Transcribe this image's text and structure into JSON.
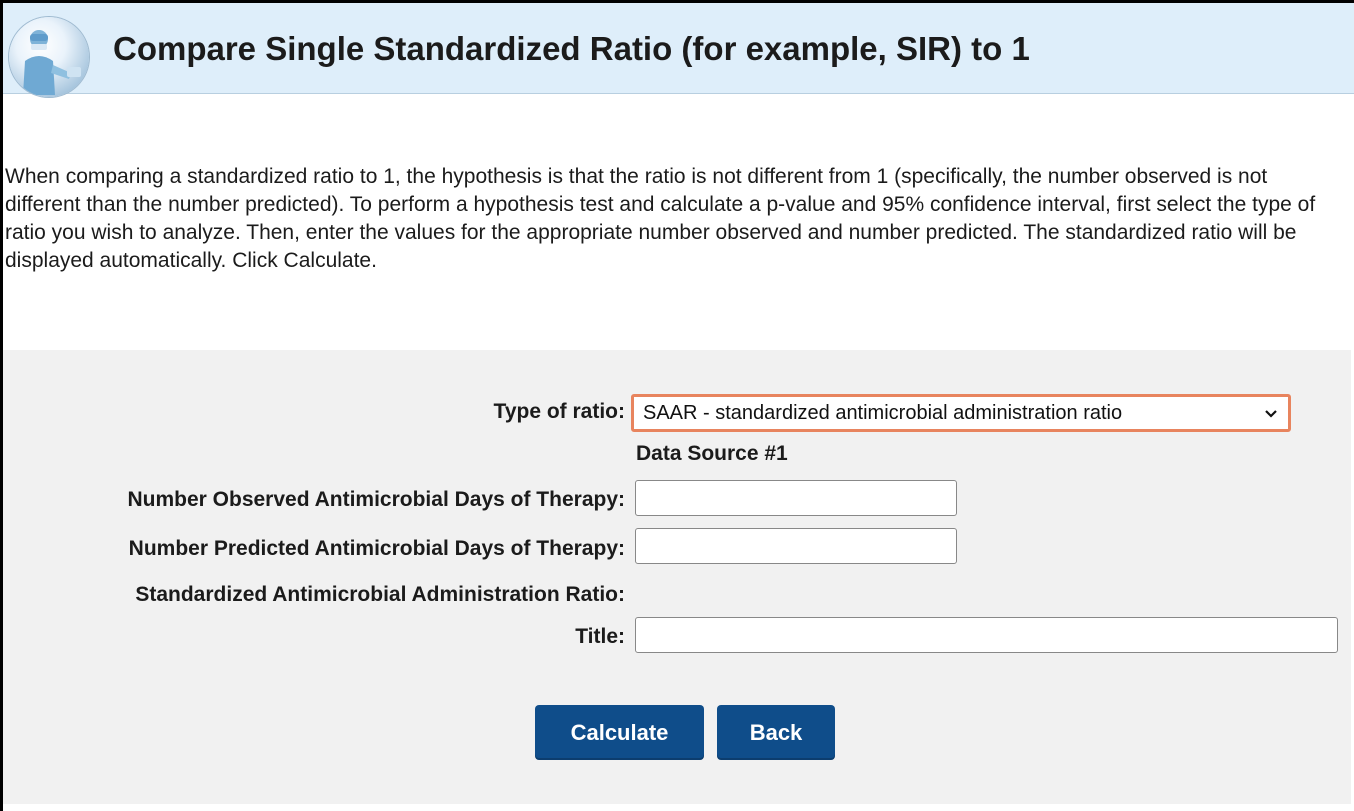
{
  "header": {
    "title": "Compare Single Standardized Ratio (for example, SIR) to 1",
    "logo_icon": "healthcare-worker-logo"
  },
  "intro": {
    "text": "When comparing a standardized ratio to 1, the hypothesis is that the ratio is not different from 1 (specifically, the number observed is not different than the number predicted). To perform a hypothesis test and calculate a p-value and 95% confidence interval, first select the type of ratio you wish to analyze. Then, enter the values for the appropriate number observed and number predicted. The standardized ratio will be displayed automatically. Click Calculate."
  },
  "form": {
    "type_of_ratio_label": "Type of ratio:",
    "type_of_ratio_selected": "SAAR - standardized antimicrobial administration ratio",
    "data_source_label": "Data Source #1",
    "observed_label": "Number Observed Antimicrobial Days of Therapy:",
    "observed_value": "",
    "predicted_label": "Number Predicted Antimicrobial Days of Therapy:",
    "predicted_value": "",
    "ratio_label": "Standardized Antimicrobial Administration Ratio:",
    "ratio_value": "",
    "title_label": "Title:",
    "title_value": ""
  },
  "buttons": {
    "calculate": "Calculate",
    "back": "Back"
  },
  "colors": {
    "header_bg": "#deeefa",
    "button_bg": "#0f4d8a",
    "highlight_border": "#e8845e",
    "form_bg": "#f1f1f1"
  }
}
